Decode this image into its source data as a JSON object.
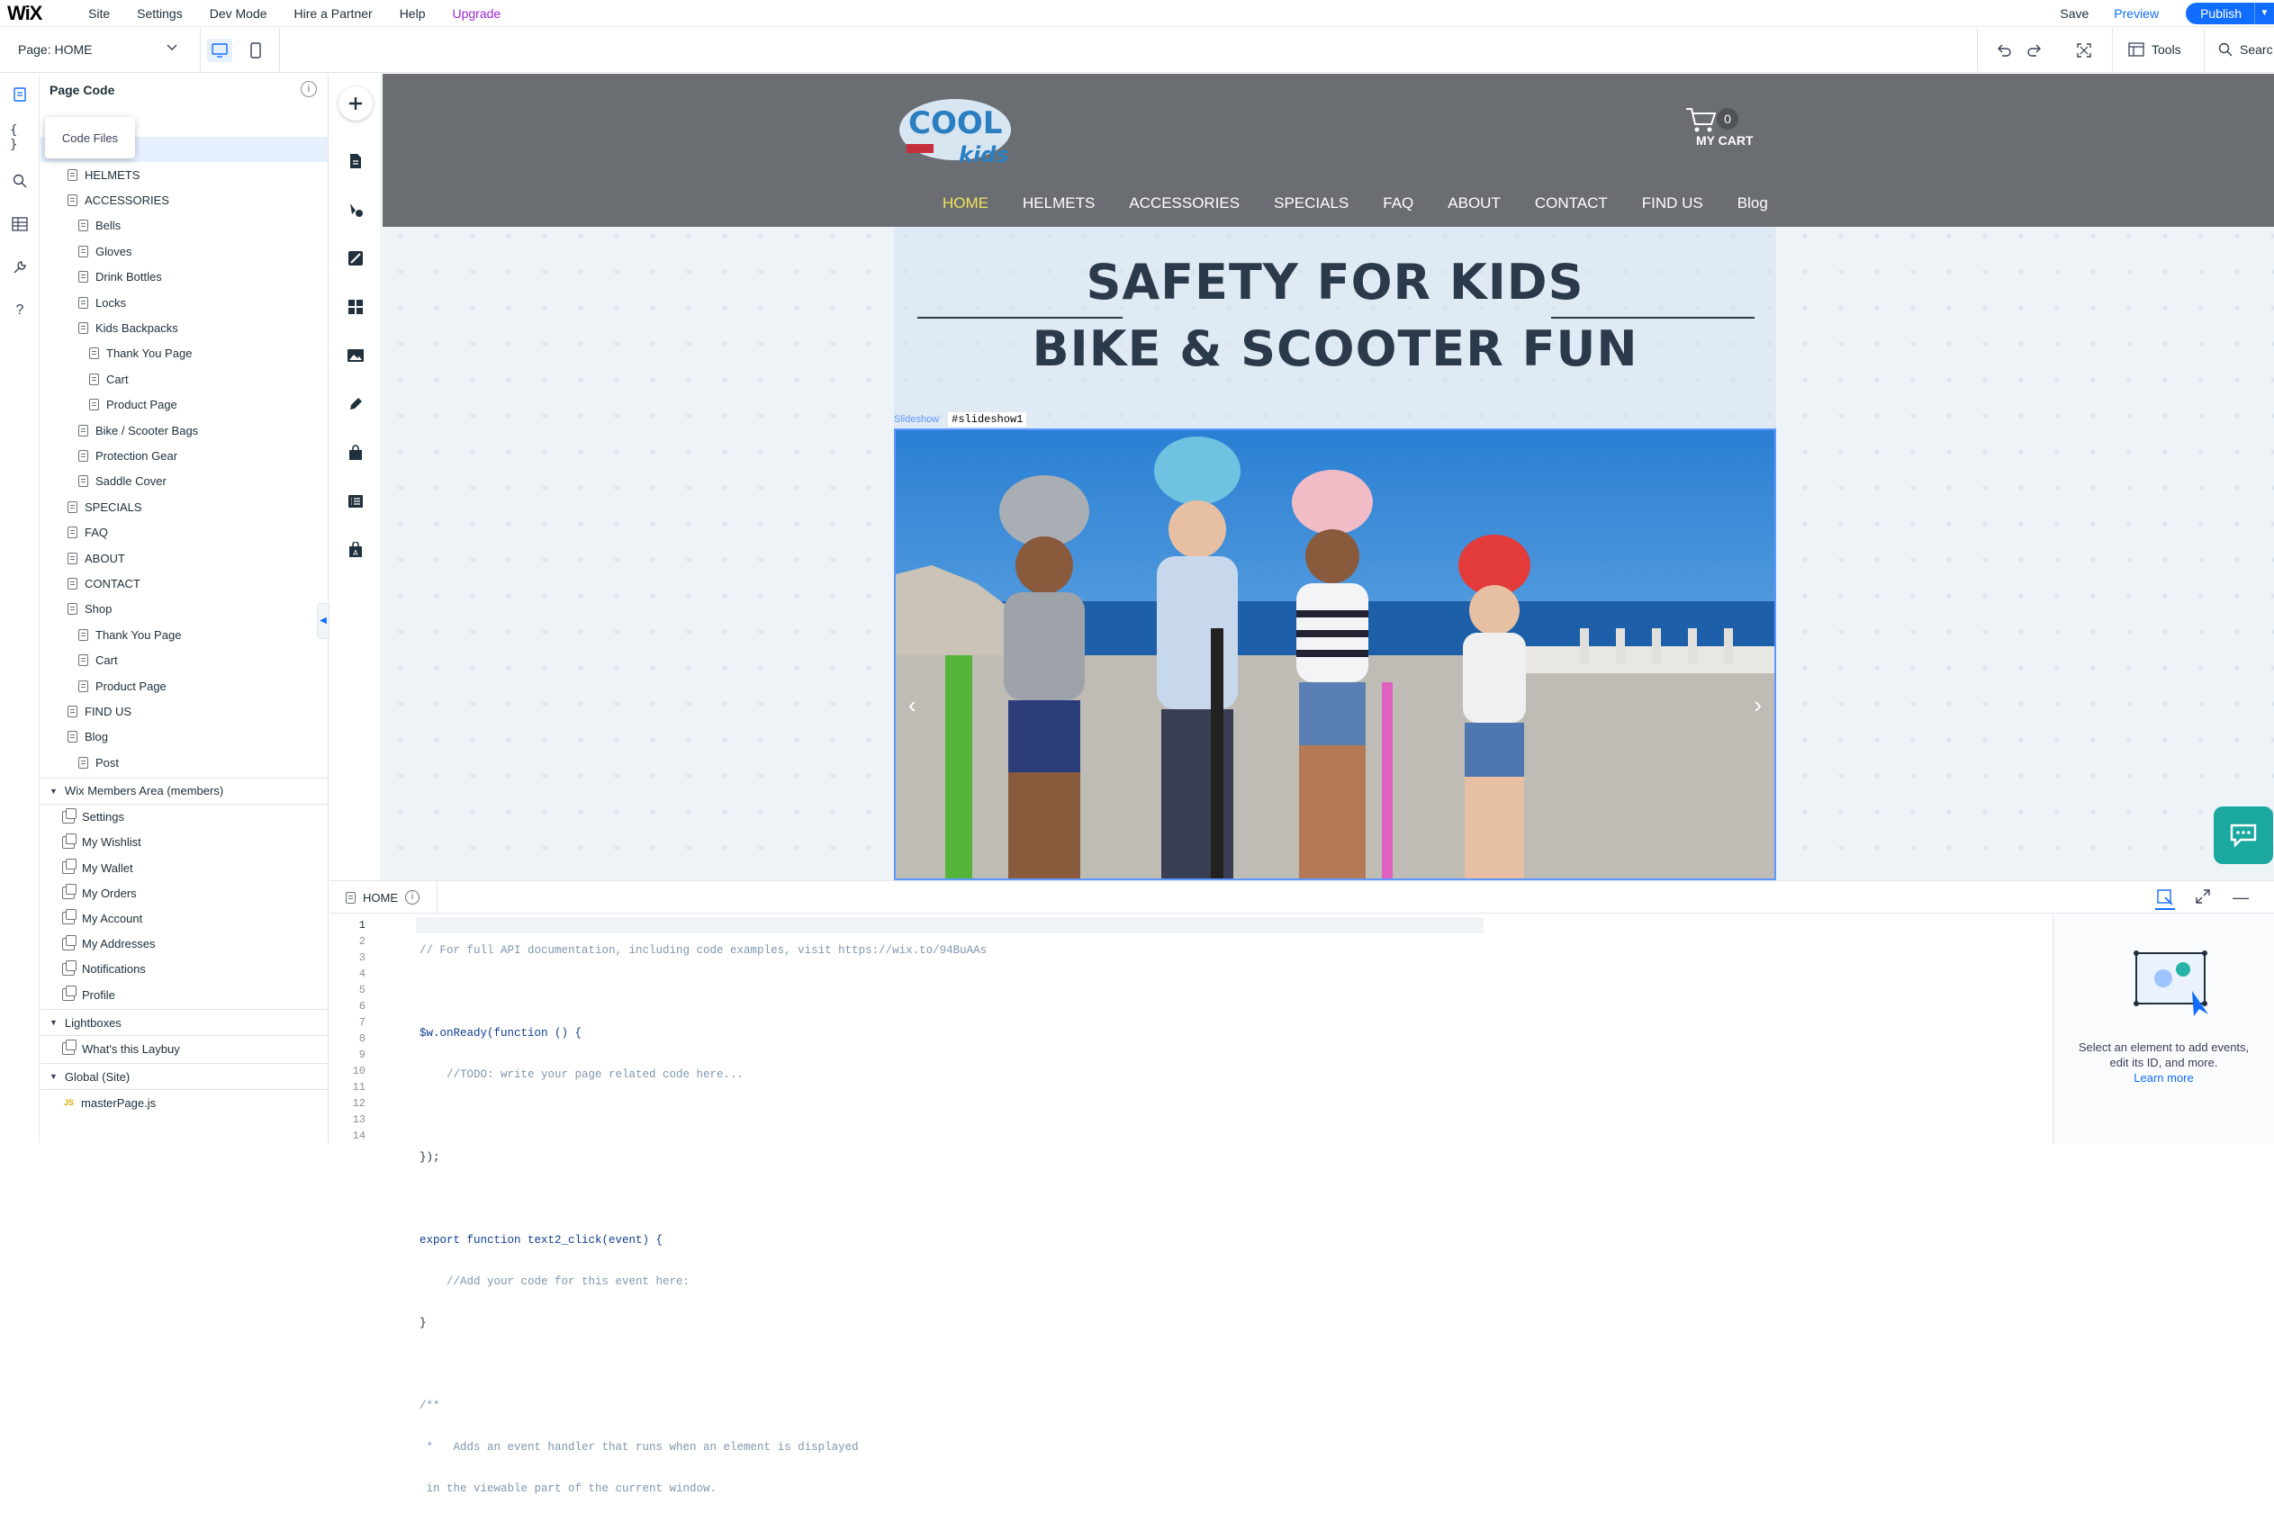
{
  "topbar": {
    "logo": "WiX",
    "menus": [
      "Site",
      "Settings",
      "Dev Mode",
      "Hire a Partner",
      "Help",
      "Upgrade"
    ],
    "save": "Save",
    "preview": "Preview",
    "publish": "Publish"
  },
  "toolbar": {
    "page_label": "Page: HOME",
    "tools": "Tools",
    "search": "Searc"
  },
  "code_panel": {
    "title": "Page Code",
    "tooltip": "Code Files",
    "pages": [
      {
        "label": "HELMETS",
        "level": 1
      },
      {
        "label": "ACCESSORIES",
        "level": 1
      },
      {
        "label": "Bells",
        "level": 2
      },
      {
        "label": "Gloves",
        "level": 2
      },
      {
        "label": "Drink Bottles",
        "level": 2
      },
      {
        "label": "Locks",
        "level": 2
      },
      {
        "label": "Kids Backpacks",
        "level": 2
      },
      {
        "label": "Thank You Page",
        "level": 3
      },
      {
        "label": "Cart",
        "level": 3
      },
      {
        "label": "Product Page",
        "level": 3
      },
      {
        "label": "Bike / Scooter Bags",
        "level": 2
      },
      {
        "label": "Protection Gear",
        "level": 2
      },
      {
        "label": "Saddle Cover",
        "level": 2
      },
      {
        "label": "SPECIALS",
        "level": 1
      },
      {
        "label": "FAQ",
        "level": 1
      },
      {
        "label": "ABOUT",
        "level": 1
      },
      {
        "label": "CONTACT",
        "level": 1
      },
      {
        "label": "Shop",
        "level": 1
      },
      {
        "label": "Thank You Page",
        "level": 2
      },
      {
        "label": "Cart",
        "level": 2
      },
      {
        "label": "Product Page",
        "level": 2
      },
      {
        "label": "FIND US",
        "level": 1
      },
      {
        "label": "Blog",
        "level": 1
      },
      {
        "label": "Post",
        "level": 2
      }
    ],
    "members_section": "Wix Members Area (members)",
    "members_pages": [
      "Settings",
      "My Wishlist",
      "My Wallet",
      "My Orders",
      "My Account",
      "My Addresses",
      "Notifications",
      "Profile"
    ],
    "lightboxes_section": "Lightboxes",
    "lightboxes": [
      "What's this Laybuy"
    ],
    "global_section": "Global (Site)",
    "global_files": [
      "masterPage.js"
    ]
  },
  "site": {
    "logo_text_1": "COOL",
    "logo_text_2": "kids",
    "cart_count": "0",
    "cart_label": "MY CART",
    "nav": [
      "HOME",
      "HELMETS",
      "ACCESSORIES",
      "SPECIALS",
      "FAQ",
      "ABOUT",
      "CONTACT",
      "FIND US",
      "Blog"
    ],
    "active_nav": "HOME",
    "hero_line1": "SAFETY FOR KIDS",
    "hero_line2": "BIKE & SCOOTER FUN",
    "slideshow_tag": "Slideshow",
    "slideshow_id": "#slideshow1"
  },
  "editor": {
    "tab": "HOME",
    "lines": [
      "1",
      "2",
      "3",
      "4",
      "5",
      "6",
      "7",
      "8",
      "9",
      "10",
      "11",
      "12",
      "13",
      "14"
    ],
    "code": [
      "// For full API documentation, including code examples, visit https://wix.to/94BuAAs",
      "",
      "$w.onReady(function () {",
      "    //TODO: write your page related code here...",
      "",
      "});",
      "",
      "export function text2_click(event) {",
      "    //Add your code for this event here:",
      "}",
      "",
      "/**",
      " *   Adds an event handler that runs when an element is displayed",
      " in the viewable part of the current window."
    ],
    "side_text_1": "Select an element to add events,",
    "side_text_2": "edit its ID, and more.",
    "learn_more": "Learn more"
  },
  "colors": {
    "accent": "#116dff",
    "upgrade": "#9a27d5",
    "site_header": "#6a6d72",
    "nav_active": "#f3e35b",
    "chat": "#1aa89f"
  }
}
